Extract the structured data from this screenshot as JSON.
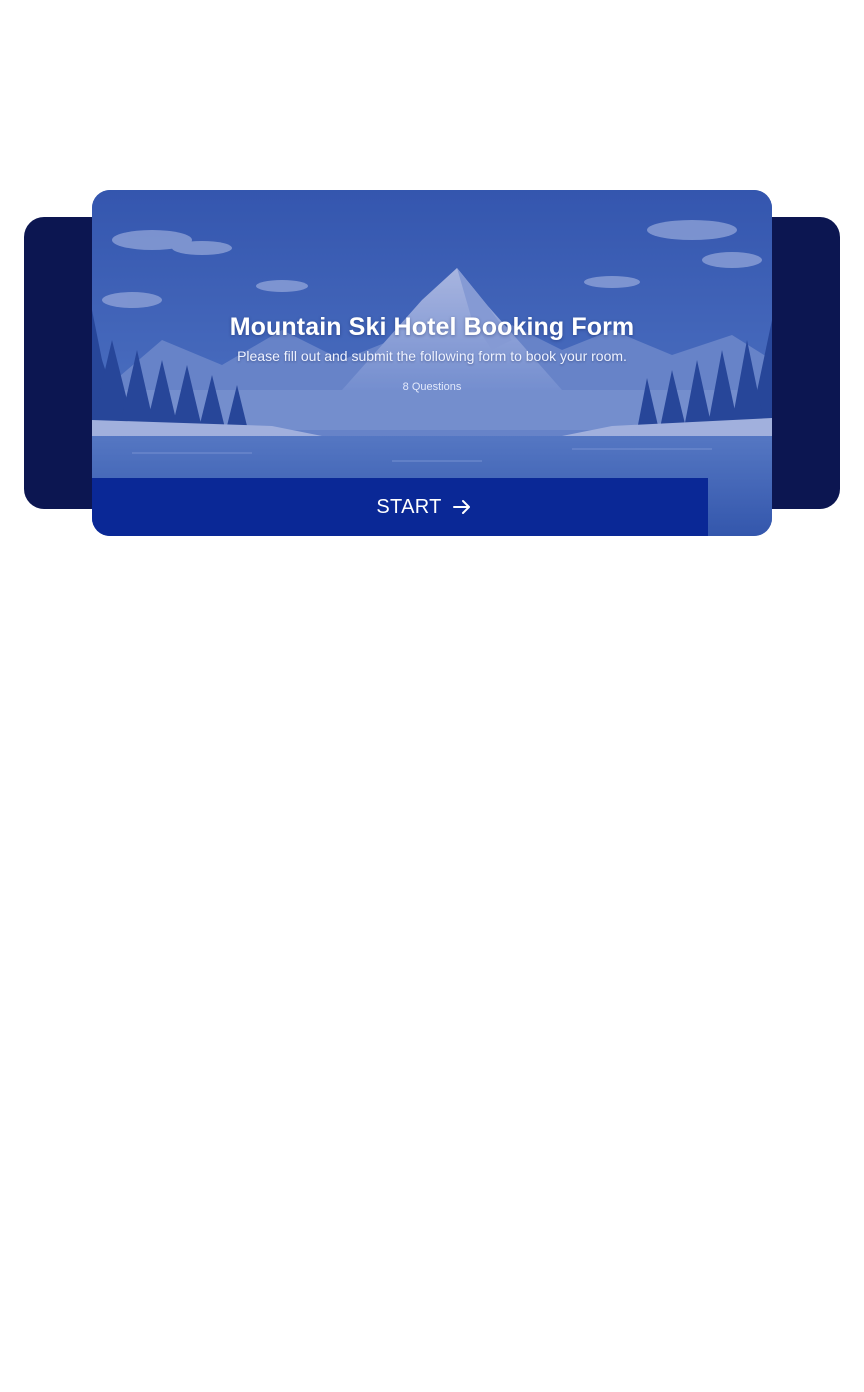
{
  "form": {
    "title": "Mountain Ski Hotel Booking Form",
    "subtitle": "Please fill out and submit the following form to book your room.",
    "question_count": "8 Questions",
    "start_label": "START",
    "start_icon": "arrow-right-icon",
    "background_image": "snowy-mountain-lake-landscape"
  },
  "colors": {
    "back_panel": "#0c1651",
    "start_button": "#0a2896",
    "text": "#ffffff"
  }
}
